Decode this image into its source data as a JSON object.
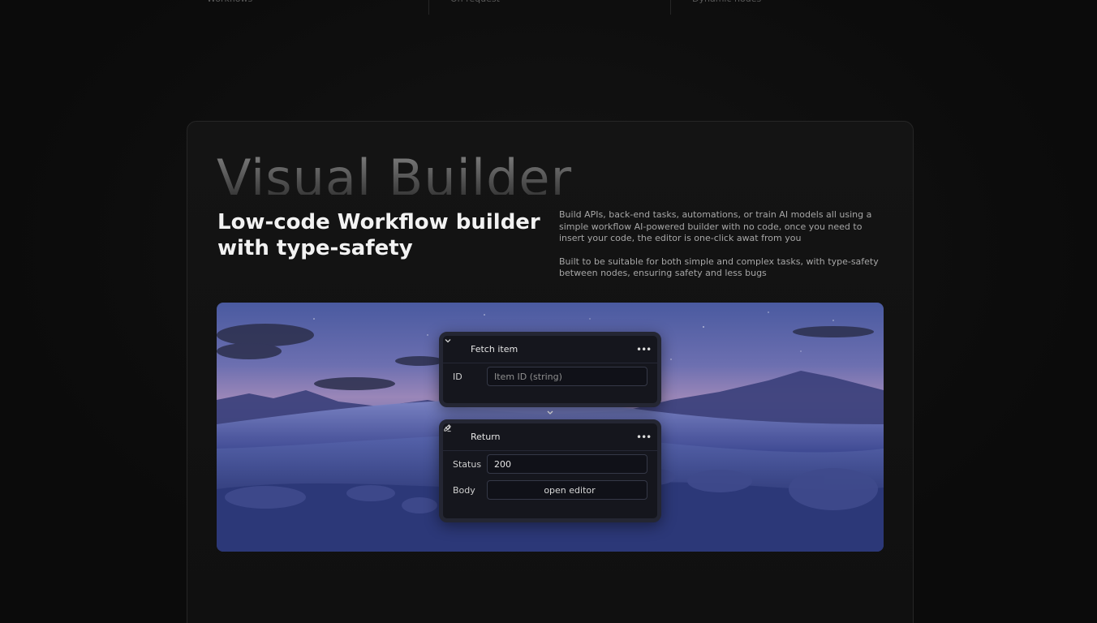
{
  "top_strip": {
    "col1": "Workflows",
    "col2": "On request",
    "col3": "Dynamic nodes"
  },
  "section": {
    "big_title": "Visual Builder",
    "headline_line1": "Low-code Workflow builder",
    "headline_line2": "with type-safety",
    "paragraph1": "Build APIs, back-end tasks, automations, or train AI models all using a simple workflow AI-powered builder with no code, once you need to insert your code, the editor is one-click awat from you",
    "paragraph2": "Built to be suitable for both simple and complex tasks, with type-safety between nodes, ensuring safety and less bugs"
  },
  "nodes": {
    "fetch": {
      "title": "Fetch item",
      "id_label": "ID",
      "id_placeholder": "Item ID (string)",
      "menu_icon": "more-horizontal-icon",
      "collapse_icon": "chevron-down-icon"
    },
    "ret": {
      "title": "Return",
      "status_label": "Status",
      "status_value": "200",
      "body_label": "Body",
      "body_button": "open editor",
      "editor_icon": "edit-icon"
    }
  },
  "colors": {
    "background": "#0b0b0b",
    "card": "#121212",
    "node": "#15161d",
    "node_border": "#242633"
  }
}
